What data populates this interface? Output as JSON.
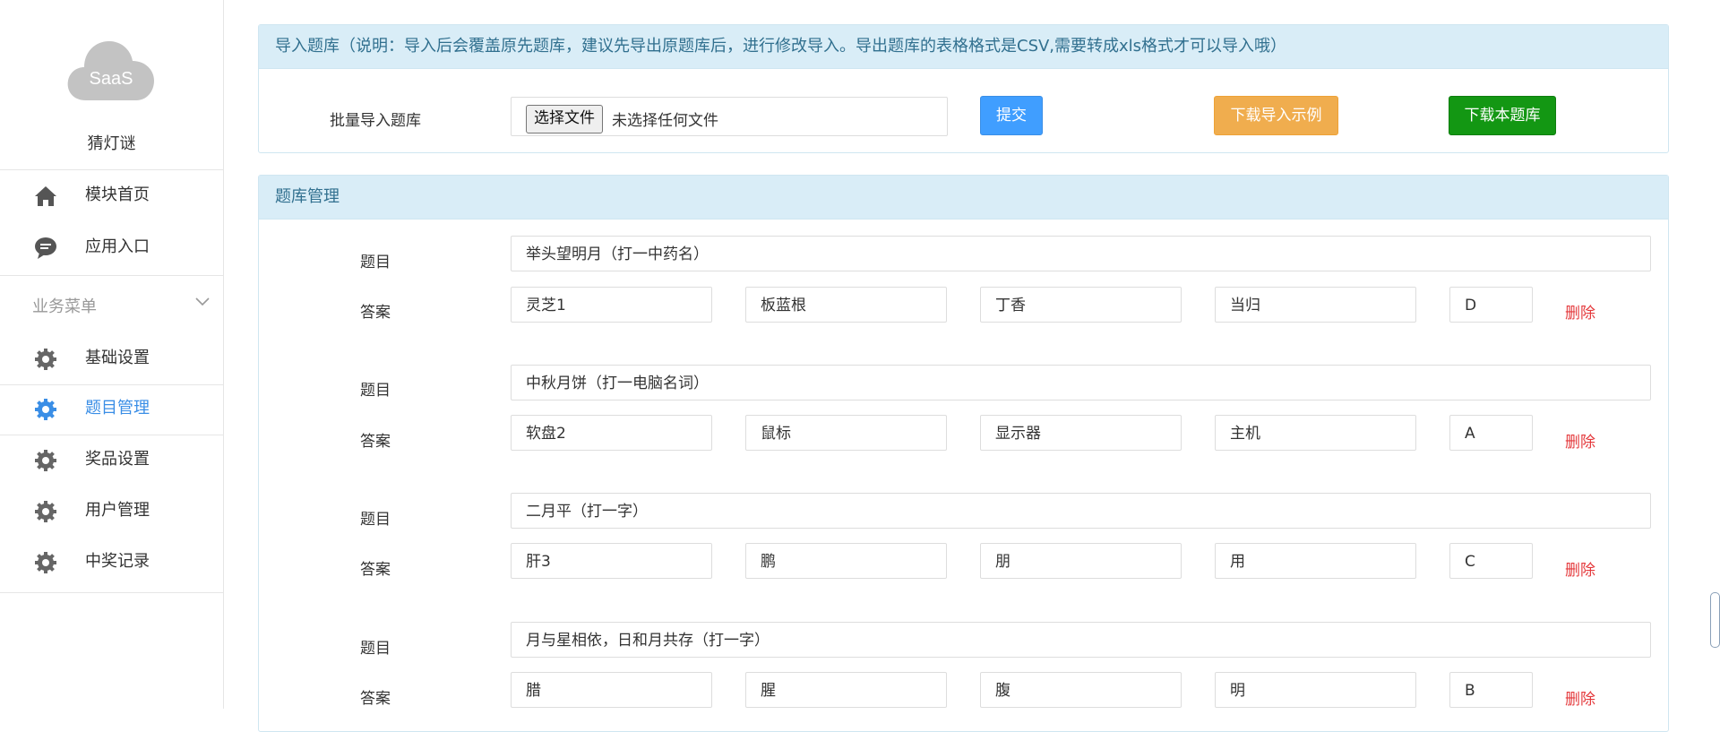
{
  "sidebar": {
    "logo_text": "SaaS",
    "app_name": "猜灯谜",
    "top_items": [
      {
        "label": "模块首页",
        "icon": "home-icon"
      },
      {
        "label": "应用入口",
        "icon": "chat-bubble-icon"
      }
    ],
    "group_label": "业务菜单",
    "group_items": [
      {
        "label": "基础设置",
        "icon": "gear-icon",
        "active": false
      },
      {
        "label": "题目管理",
        "icon": "gear-icon",
        "active": true
      },
      {
        "label": "奖品设置",
        "icon": "gear-icon",
        "active": false
      },
      {
        "label": "用户管理",
        "icon": "gear-icon",
        "active": false
      },
      {
        "label": "中奖记录",
        "icon": "gear-icon",
        "active": false
      }
    ],
    "active_color": "#3a8ee6"
  },
  "import_panel": {
    "title": "导入题库（说明：导入后会覆盖原先题库，建议先导出原题库后，进行修改导入。导出题库的表格格式是CSV,需要转成xls格式才可以导入哦）",
    "field_label": "批量导入题库",
    "file_button": "选择文件",
    "file_status": "未选择任何文件",
    "submit_label": "提交",
    "example_label": "下载导入示例",
    "download_label": "下载本题库"
  },
  "manage_panel": {
    "title": "题库管理",
    "question_label": "题目",
    "answer_label": "答案",
    "delete_label": "删除",
    "questions": [
      {
        "question": "举头望明月（打一中药名）",
        "options": [
          "灵芝1",
          "板蓝根",
          "丁香",
          "当归"
        ],
        "answer": "D"
      },
      {
        "question": "中秋月饼（打一电脑名词）",
        "options": [
          "软盘2",
          "鼠标",
          "显示器",
          "主机"
        ],
        "answer": "A"
      },
      {
        "question": "二月平（打一字）",
        "options": [
          "肝3",
          "鹏",
          "朋",
          "用"
        ],
        "answer": "C"
      },
      {
        "question": "月与星相依，日和月共存（打一字）",
        "options": [
          "腊",
          "腥",
          "腹",
          "明"
        ],
        "answer": "B"
      }
    ]
  },
  "colors": {
    "panel_header_bg": "#d9edf7",
    "panel_header_text": "#31708f",
    "submit": "#409eff",
    "example": "#f0ad4e",
    "download": "#139713",
    "delete": "#e4393c"
  }
}
